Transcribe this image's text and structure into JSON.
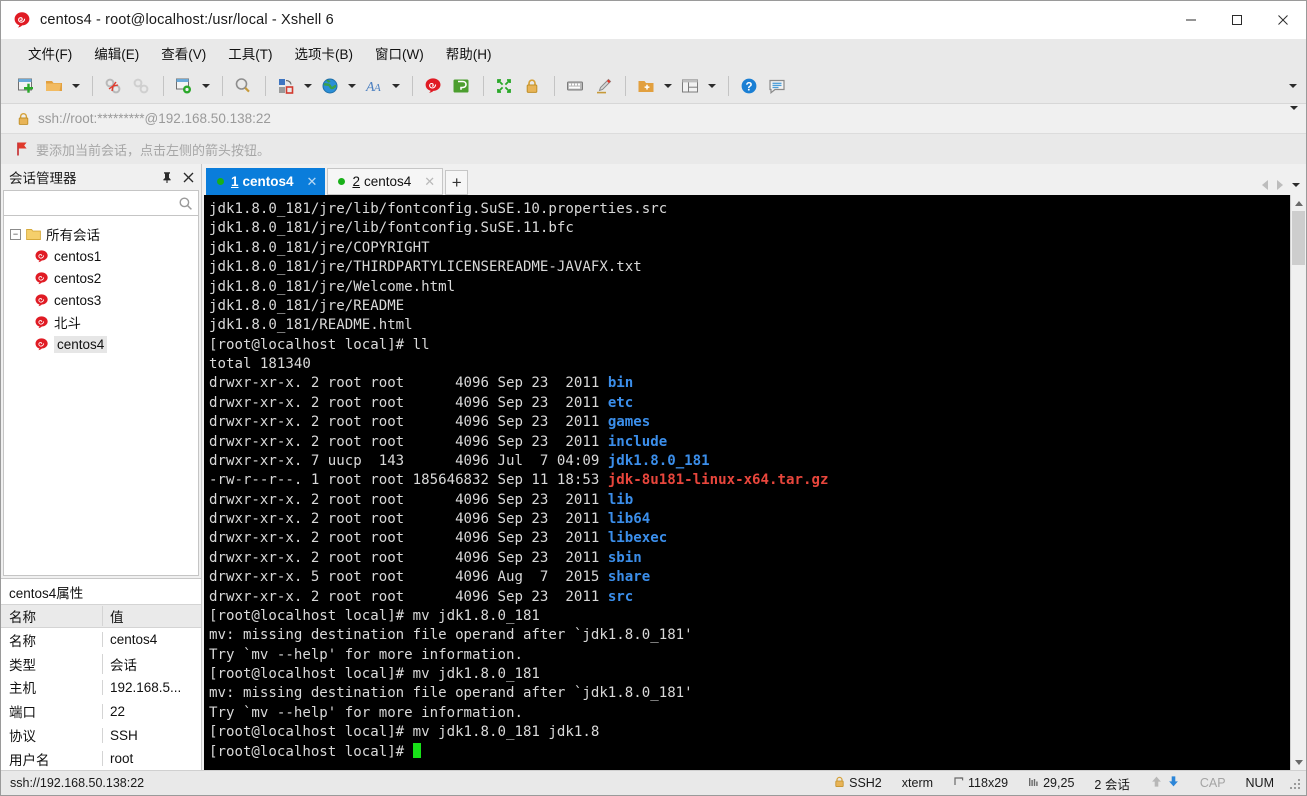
{
  "window": {
    "title": "centos4 - root@localhost:/usr/local - Xshell 6",
    "app_icon": "xshell-logo-icon",
    "minimize_label": "—",
    "maximize_label": "□",
    "close_label": "✕"
  },
  "menubar": {
    "items": [
      {
        "label": "文件(F)",
        "name": "menu-file"
      },
      {
        "label": "编辑(E)",
        "name": "menu-edit"
      },
      {
        "label": "查看(V)",
        "name": "menu-view"
      },
      {
        "label": "工具(T)",
        "name": "menu-tools"
      },
      {
        "label": "选项卡(B)",
        "name": "menu-tabs"
      },
      {
        "label": "窗口(W)",
        "name": "menu-window"
      },
      {
        "label": "帮助(H)",
        "name": "menu-help"
      }
    ]
  },
  "toolbar": {
    "icons": [
      "new-session-icon",
      "open-folder-icon",
      "disconnect-icon",
      "reconnect-icon",
      "session-properties-icon",
      "find-icon",
      "transfer-file-icon",
      "globe-icon",
      "font-icon",
      "xshell-icon",
      "xftp-icon",
      "fullscreen-icon",
      "lock-icon",
      "keyboard-icon",
      "highlight-icon",
      "new-folder-icon",
      "layout-icon",
      "help-icon",
      "comment-icon"
    ],
    "overflow_icon": "chevron-down-icon"
  },
  "address_bar": {
    "lock_icon": "lock-icon",
    "url": "ssh://root:*********@192.168.50.138:22",
    "dropdown_icon": "chevron-down-icon"
  },
  "hint_bar": {
    "flag_icon": "red-flag-icon",
    "text": "要添加当前会话，点击左侧的箭头按钮。"
  },
  "session_manager": {
    "title": "会话管理器",
    "pin_icon": "pin-icon",
    "close_icon": "close-icon",
    "search": {
      "value": "",
      "placeholder": "",
      "icon": "search-icon"
    },
    "root": {
      "label": "所有会话",
      "icon": "folder-icon",
      "expander": "−"
    },
    "sessions": [
      {
        "label": "centos1",
        "icon": "xshell-session-icon",
        "selected": false
      },
      {
        "label": "centos2",
        "icon": "xshell-session-icon",
        "selected": false
      },
      {
        "label": "centos3",
        "icon": "xshell-session-icon",
        "selected": false
      },
      {
        "label": "北斗",
        "icon": "xshell-session-icon",
        "selected": false
      },
      {
        "label": "centos4",
        "icon": "xshell-session-icon",
        "selected": true
      }
    ]
  },
  "properties": {
    "title": "centos4属性",
    "header": {
      "name": "名称",
      "value": "值"
    },
    "rows": [
      {
        "name": "名称",
        "value": "centos4"
      },
      {
        "name": "类型",
        "value": "会话"
      },
      {
        "name": "主机",
        "value": "192.168.5..."
      },
      {
        "name": "端口",
        "value": "22"
      },
      {
        "name": "协议",
        "value": "SSH"
      },
      {
        "name": "用户名",
        "value": "root"
      }
    ]
  },
  "tabs": {
    "items": [
      {
        "num": "1",
        "label": "centos4",
        "active": true,
        "status": "connected",
        "close_label": "✕"
      },
      {
        "num": "2",
        "label": "centos4",
        "active": false,
        "status": "connected",
        "close_label": "✕"
      }
    ],
    "add_label": "+",
    "prev_icon": "chevron-left-icon",
    "next_icon": "chevron-right-icon",
    "menu_icon": "chevron-down-icon"
  },
  "terminal": {
    "colors": {
      "background": "#000000",
      "foreground": "#d9d9d9",
      "dir": "#3b8eea",
      "archive": "#e8463c",
      "cursor": "#18e018"
    },
    "lines": [
      [
        {
          "t": "jdk1.8.0_181/jre/lib/fontconfig.SuSE.10.properties.src",
          "c": "white"
        }
      ],
      [
        {
          "t": "jdk1.8.0_181/jre/lib/fontconfig.SuSE.11.bfc",
          "c": "white"
        }
      ],
      [
        {
          "t": "jdk1.8.0_181/jre/COPYRIGHT",
          "c": "white"
        }
      ],
      [
        {
          "t": "jdk1.8.0_181/jre/THIRDPARTYLICENSEREADME-JAVAFX.txt",
          "c": "white"
        }
      ],
      [
        {
          "t": "jdk1.8.0_181/jre/Welcome.html",
          "c": "white"
        }
      ],
      [
        {
          "t": "jdk1.8.0_181/jre/README",
          "c": "white"
        }
      ],
      [
        {
          "t": "jdk1.8.0_181/README.html",
          "c": "white"
        }
      ],
      [
        {
          "t": "[root@localhost local]# ll",
          "c": "white"
        }
      ],
      [
        {
          "t": "total 181340",
          "c": "white"
        }
      ],
      [
        {
          "t": "drwxr-xr-x. 2 root root      4096 Sep 23  2011 ",
          "c": "white"
        },
        {
          "t": "bin",
          "c": "blue"
        }
      ],
      [
        {
          "t": "drwxr-xr-x. 2 root root      4096 Sep 23  2011 ",
          "c": "white"
        },
        {
          "t": "etc",
          "c": "blue"
        }
      ],
      [
        {
          "t": "drwxr-xr-x. 2 root root      4096 Sep 23  2011 ",
          "c": "white"
        },
        {
          "t": "games",
          "c": "blue"
        }
      ],
      [
        {
          "t": "drwxr-xr-x. 2 root root      4096 Sep 23  2011 ",
          "c": "white"
        },
        {
          "t": "include",
          "c": "blue"
        }
      ],
      [
        {
          "t": "drwxr-xr-x. 7 uucp  143      4096 Jul  7 04:09 ",
          "c": "white"
        },
        {
          "t": "jdk1.8.0_181",
          "c": "blue"
        }
      ],
      [
        {
          "t": "-rw-r--r--. 1 root root 185646832 Sep 11 18:53 ",
          "c": "white"
        },
        {
          "t": "jdk-8u181-linux-x64.tar.gz",
          "c": "red"
        }
      ],
      [
        {
          "t": "drwxr-xr-x. 2 root root      4096 Sep 23  2011 ",
          "c": "white"
        },
        {
          "t": "lib",
          "c": "blue"
        }
      ],
      [
        {
          "t": "drwxr-xr-x. 2 root root      4096 Sep 23  2011 ",
          "c": "white"
        },
        {
          "t": "lib64",
          "c": "blue"
        }
      ],
      [
        {
          "t": "drwxr-xr-x. 2 root root      4096 Sep 23  2011 ",
          "c": "white"
        },
        {
          "t": "libexec",
          "c": "blue"
        }
      ],
      [
        {
          "t": "drwxr-xr-x. 2 root root      4096 Sep 23  2011 ",
          "c": "white"
        },
        {
          "t": "sbin",
          "c": "blue"
        }
      ],
      [
        {
          "t": "drwxr-xr-x. 5 root root      4096 Aug  7  2015 ",
          "c": "white"
        },
        {
          "t": "share",
          "c": "blue"
        }
      ],
      [
        {
          "t": "drwxr-xr-x. 2 root root      4096 Sep 23  2011 ",
          "c": "white"
        },
        {
          "t": "src",
          "c": "blue"
        }
      ],
      [
        {
          "t": "[root@localhost local]# mv jdk1.8.0_181",
          "c": "white"
        }
      ],
      [
        {
          "t": "mv: missing destination file operand after `jdk1.8.0_181'",
          "c": "white"
        }
      ],
      [
        {
          "t": "Try `mv --help' for more information.",
          "c": "white"
        }
      ],
      [
        {
          "t": "[root@localhost local]# mv jdk1.8.0_181",
          "c": "white"
        }
      ],
      [
        {
          "t": "mv: missing destination file operand after `jdk1.8.0_181'",
          "c": "white"
        }
      ],
      [
        {
          "t": "Try `mv --help' for more information.",
          "c": "white"
        }
      ],
      [
        {
          "t": "[root@localhost local]# mv jdk1.8.0_181 jdk1.8",
          "c": "white"
        }
      ],
      [
        {
          "t": "[root@localhost local]# ",
          "c": "white"
        },
        {
          "t": "",
          "c": "cursor"
        }
      ]
    ]
  },
  "status_bar": {
    "left": "ssh://192.168.50.138:22",
    "lock_icon": "lock-icon",
    "protocol": "SSH2",
    "term_type": "xterm",
    "size_icon": "resize-icon",
    "size": "118x29",
    "cursor_icon": "cursor-pos-icon",
    "cursor_pos": "29,25",
    "sessions": "2 会话",
    "up_icon": "arrow-up-icon",
    "down_icon": "arrow-down-icon",
    "cap": "CAP",
    "num": "NUM"
  }
}
